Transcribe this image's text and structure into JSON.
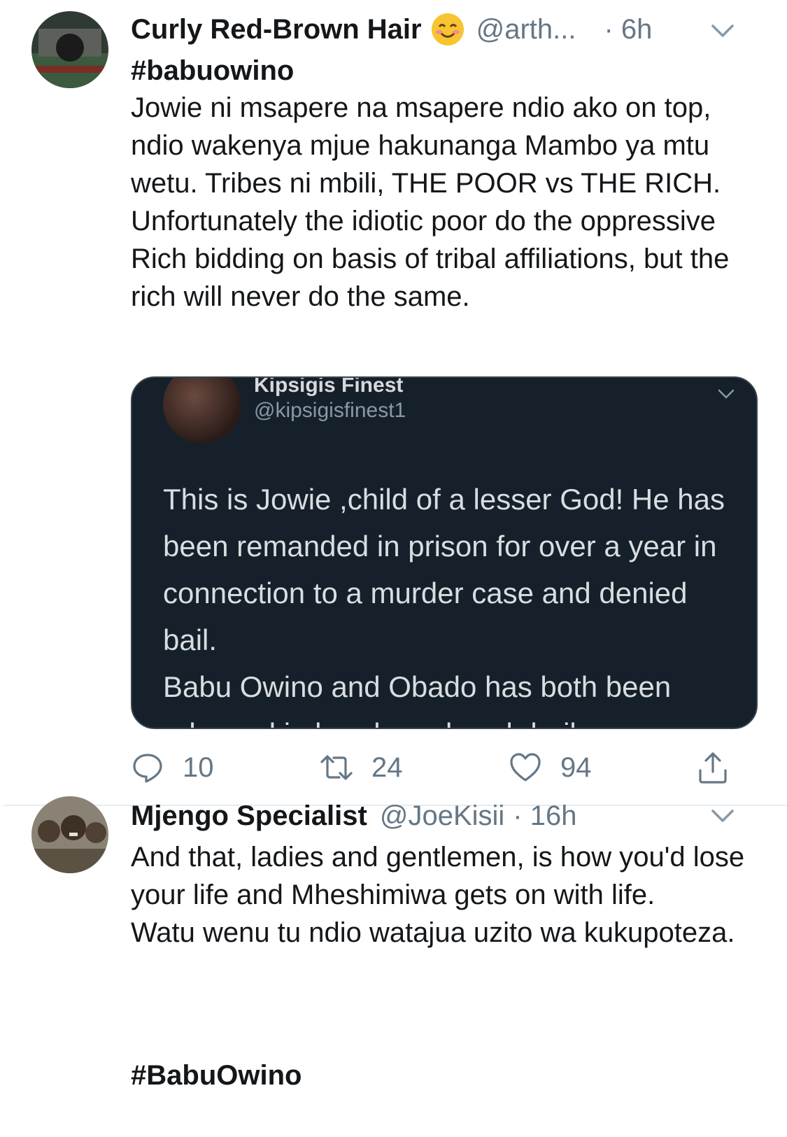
{
  "tweets": [
    {
      "author_name": "Curly Red-Brown Hair",
      "emoji_icon": "smiling-face-emoji",
      "handle": "@arth...",
      "time": "· 6h",
      "hashtag": "#babuowino",
      "text": "Jowie ni msapere na msapere ndio ako on top, ndio wakenya mjue hakunanga Mambo ya mtu wetu. Tribes ni mbili, THE POOR vs THE RICH. Unfortunately the idiotic poor do the oppressive Rich bidding on basis of tribal affiliations, but the rich will never do the same.",
      "embedded": {
        "name": "Kipsigis Finest",
        "handle": "@kipsigisfinest1",
        "text": "This is Jowie ,child of a lesser God! He has been remanded in prison for over a year in connection to a murder case and denied bail.\nBabu Owino and Obado has both been released in bonds and cash bail"
      },
      "actions": {
        "reply_count": "10",
        "retweet_count": "24",
        "like_count": "94"
      }
    },
    {
      "author_name": "Mjengo Specialist",
      "handle": "@JoeKisii",
      "time": "· 16h",
      "text": "And that, ladies and gentlemen, is how you'd lose your life and Mheshimiwa gets on with life.\nWatu wenu tu ndio watajua uzito wa kukupoteza.",
      "hashtag": "#BabuOwino"
    }
  ],
  "colors": {
    "link": "#1b95e0",
    "secondary_text": "#657786",
    "embed_background": "#15202b"
  }
}
